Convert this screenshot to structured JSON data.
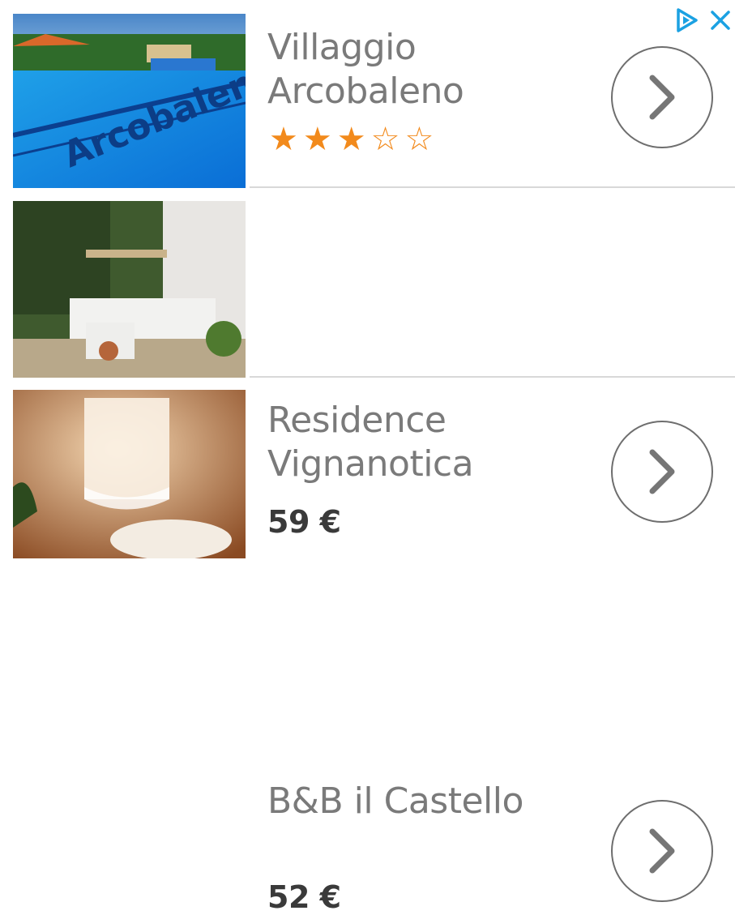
{
  "header": {
    "adchoices_icon": "adchoices-triangle-icon",
    "close_icon": "close-icon",
    "accent_color": "#1ba1e2"
  },
  "listings": [
    {
      "name": "Villaggio\nArcobaleno",
      "rating_stars": 3,
      "rating_max": 5,
      "photo_text": "Arcobaleno"
    },
    {
      "name": "Residence\nVignanotica",
      "price": "59 €"
    },
    {
      "name": "B&B il Castello",
      "price": "52 €"
    }
  ],
  "star_filled": "★",
  "star_empty": "☆",
  "star_color": "#f28a1c"
}
